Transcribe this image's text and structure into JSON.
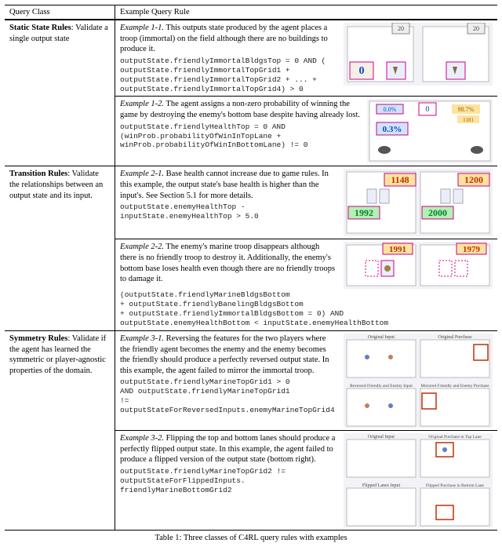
{
  "header": {
    "left": "Query Class",
    "right": "Example Query Rule"
  },
  "groups": [
    {
      "title": "Static State Rules",
      "desc": ": Validate a single output state",
      "examples": [
        {
          "num": "Example 1-1.",
          "text": "This outputs state produced by the agent places a troop (immortal) on the field although there are no buildings to produce it.",
          "code": "outputState.friendlyImmortalBldgsTop = 0 AND (\noutputState.friendlyImmortalTopGrid1 +\noutputState.friendlyImmortalTopGrid2 + ... +\noutputState.friendlyImmortalTopGrid4) > 0",
          "fig": "f11"
        },
        {
          "num": "Example 1-2.",
          "text": "The agent assigns a non-zero probability of winning the game by destroying the enemy's bottom base despite having already lost.",
          "code": "outputState.friendlyHealthTop = 0 AND\n(winProb.probabilityOfWinInTopLane +\nwinProb.probabilityOfWinInBottomLane) != 0",
          "fig": "f12",
          "inline_code_start": true
        }
      ]
    },
    {
      "title": "Transition Rules",
      "desc": ": Validate the relationships between an output state and its input.",
      "examples": [
        {
          "num": "Example 2-1.",
          "text": "Base health cannot increase due to game rules. In this example, the output state's base health is higher than the input's. See Section 5.1 for more details.",
          "code": "outputState.enemyHealthTop -\ninputState.enemyHealthTop > 5.0",
          "fig": "f21"
        },
        {
          "num": "Example 2-2.",
          "text": "The enemy's marine troop disappears although there is no friendly troop to destroy it. Additionally, the enemy's bottom base loses health even though there are no friendly troops to damage it.",
          "code": "(outputState.friendlyMarineBldgsBottom\n+ outputState.friendlyBanelingBldgsBottom\n+ outputState.friendlyImmortalBldgsBottom = 0) AND\noutputState.enemyHealthBottom < inputState.enemyHealthBottom",
          "fig": "f22"
        }
      ]
    },
    {
      "title": "Symmetry Rules",
      "desc": ": Validate if the agent has learned the symmetric or player-agnostic properties of the domain.",
      "examples": [
        {
          "num": "Example 3-1.",
          "text": "Reversing the features for the two players where the friendly agent becomes the enemy and the enemy becomes the friendly should produce a perfectly reversed output state. In this example, the agent failed to mirror the immortal troop.",
          "code": "outputState.friendlyMarineTopGrid1 > 0\nAND outputState.friendlyMarineTopGrid1\n!= outputStateForReversedInputs.enemyMarineTopGrid4",
          "fig": "f31"
        },
        {
          "num": "Example 3-2.",
          "text": "Flipping the top and bottom lanes should produce a perfectly flipped output state. In this example, the agent failed to produce a flipped version of the output state (bottom right).",
          "code": "outputState.friendlyMarineTopGrid2 !=\noutputStateForFlippedInputs.\nfriendlyMarineBottomGrid2",
          "fig": "f32"
        }
      ]
    }
  ],
  "caption": "Table 1: Three classes of C4RL query rules with examples",
  "figlabels": {
    "f11": {
      "nums": [
        "0",
        ""
      ],
      "tags": [
        "20",
        "20"
      ]
    },
    "f12": {
      "pcts": [
        "0.0%",
        "0.3%",
        "98.7%"
      ],
      "val": "0",
      "extra": "1181"
    },
    "f21": {
      "a": "1148",
      "b": "1200",
      "c": "1992",
      "d": "2000"
    },
    "f22": {
      "a": "1991",
      "b": "1979"
    },
    "f31": {
      "t1": "Original Input",
      "t2": "Original Purchase",
      "t3": "Reversed Friendly and Enemy Input",
      "t4": "Mirrored Friendly and Enemy Purchase"
    },
    "f32": {
      "t1": "Original Input",
      "t2": "Original Purchase in Top Lane",
      "t3": "Flipped Lanes Input",
      "t4": "Flipped Purchase in Bottom Lane"
    }
  }
}
